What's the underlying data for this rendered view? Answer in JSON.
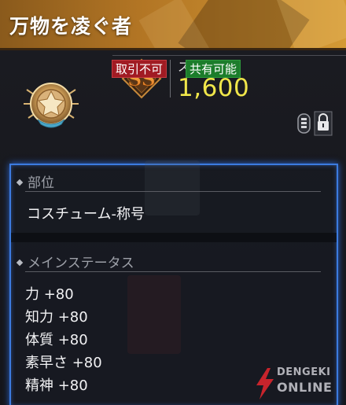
{
  "item": {
    "name": "万物を凌ぐ者",
    "grade": "SS",
    "score_label": "スコア:",
    "score_value": "1,600",
    "trade_badge": "取引不可",
    "share_badge": "共有可能"
  },
  "details": {
    "part_heading": "部位",
    "part_value": "コスチューム-称号",
    "main_stats_heading": "メインステータス",
    "stats": [
      "力 +80",
      "知力 +80",
      "体質 +80",
      "素早さ +80",
      "精神 +80"
    ]
  },
  "watermark": {
    "line1": "DENGEKI",
    "line2": "ONLINE"
  },
  "colors": {
    "title_bar": "#b27524",
    "score": "#f0e64a",
    "trade_badge": "#a11b23",
    "share_badge": "#1c7d2b",
    "detail_border": "#3c7be0"
  },
  "icons": [
    "emblem-icon",
    "grade-ss-icon",
    "lock-toggle-icon",
    "diamond-bullet-icon",
    "watermark-logo-icon"
  ]
}
